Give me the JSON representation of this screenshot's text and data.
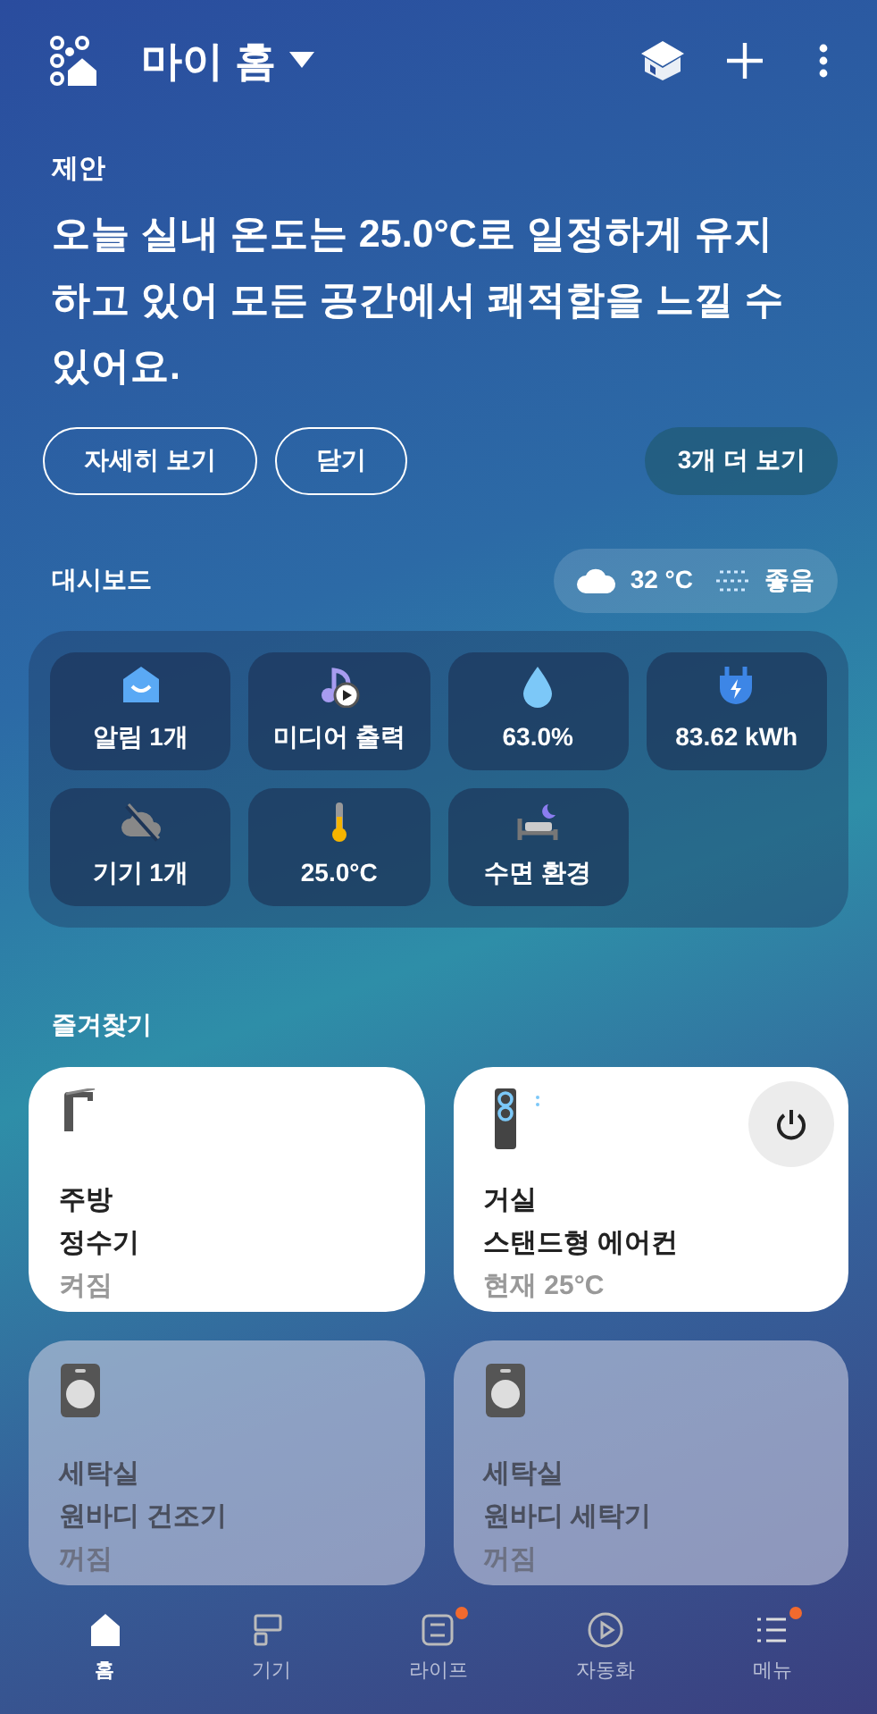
{
  "header": {
    "title": "마이 홈"
  },
  "suggestion": {
    "label": "제안",
    "message": "오늘 실내 온도는 25.0°C로 일정하게 유지하고 있어 모든 공간에서 쾌적함을 느낄 수 있어요.",
    "buttons": [
      "자세히 보기",
      "닫기"
    ],
    "more_button": "3개 더 보기"
  },
  "dashboard": {
    "label": "대시보드",
    "weather": {
      "temperature": "32 °C",
      "air_quality": "좋음"
    },
    "tiles": [
      {
        "kind": "alert",
        "label": "알림 1개"
      },
      {
        "kind": "media",
        "label": "미디어 출력"
      },
      {
        "kind": "humidity",
        "label": "63.0%"
      },
      {
        "kind": "energy",
        "label": "83.62 kWh"
      },
      {
        "kind": "offline",
        "label": "기기 1개"
      },
      {
        "kind": "temperature",
        "label": "25.0°C"
      },
      {
        "kind": "sleep",
        "label": "수면 환경"
      }
    ]
  },
  "favorites": {
    "label": "즐겨찾기",
    "devices": [
      {
        "kind": "purifier",
        "room": "주방",
        "name": "정수기",
        "status": "켜짐",
        "on": true,
        "power_button": false
      },
      {
        "kind": "aircon",
        "room": "거실",
        "name": "스탠드형 에어컨",
        "status": "현재 25°C",
        "on": true,
        "power_button": true
      },
      {
        "kind": "washer",
        "room": "세탁실",
        "name": "원바디 건조기",
        "status": "꺼짐",
        "on": false,
        "power_button": false
      },
      {
        "kind": "washer",
        "room": "세탁실",
        "name": "원바디 세탁기",
        "status": "꺼짐",
        "on": false,
        "power_button": false
      }
    ]
  },
  "nav": [
    {
      "kind": "home",
      "label": "홈",
      "selected": true,
      "badge": false
    },
    {
      "kind": "devices",
      "label": "기기",
      "selected": false,
      "badge": false
    },
    {
      "kind": "life",
      "label": "라이프",
      "selected": false,
      "badge": true
    },
    {
      "kind": "automation",
      "label": "자동화",
      "selected": false,
      "badge": false
    },
    {
      "kind": "menu",
      "label": "메뉴",
      "selected": false,
      "badge": true
    }
  ]
}
